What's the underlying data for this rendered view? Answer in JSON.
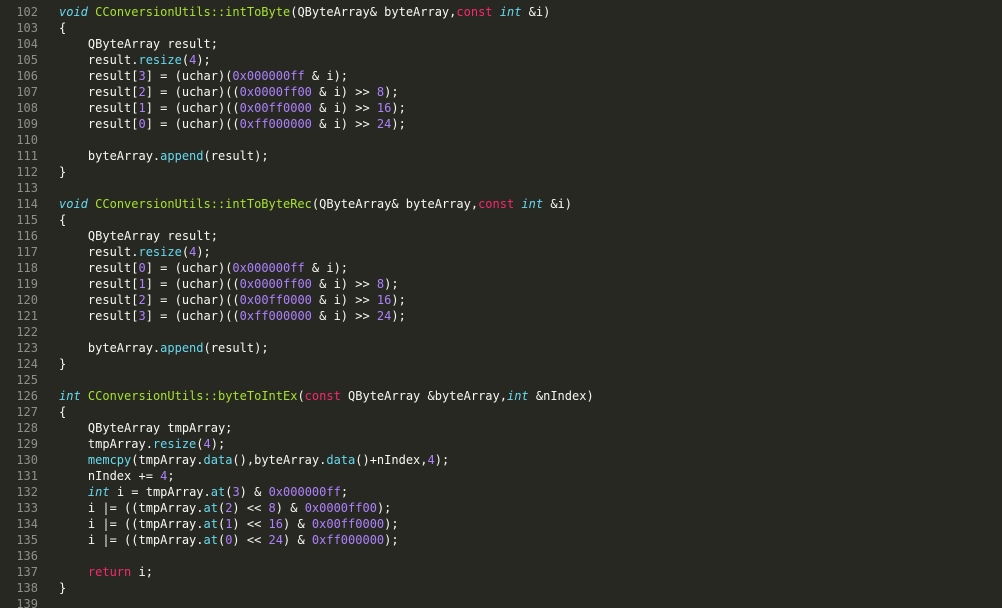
{
  "editor": {
    "theme_colors": {
      "background": "#272822",
      "line_number": "#8f908a",
      "keyword_type": "#66d9ef",
      "keyword_control": "#f92672",
      "number": "#ae81ff",
      "function_name": "#a6e22e",
      "text": "#f8f8f2"
    },
    "lines": [
      {
        "n": "102",
        "tokens": [
          [
            "kw",
            "void"
          ],
          [
            "pl",
            " "
          ],
          [
            "fn",
            "CConversionUtils::intToByte"
          ],
          [
            "pl",
            "(QByteArray& byteArray,"
          ],
          [
            "kw2",
            "const"
          ],
          [
            "pl",
            " "
          ],
          [
            "kw",
            "int"
          ],
          [
            "pl",
            " &i)"
          ]
        ]
      },
      {
        "n": "103",
        "tokens": [
          [
            "pl",
            "{"
          ]
        ]
      },
      {
        "n": "104",
        "tokens": [
          [
            "pl",
            "    QByteArray result;"
          ]
        ]
      },
      {
        "n": "105",
        "tokens": [
          [
            "pl",
            "    result."
          ],
          [
            "fn2",
            "resize"
          ],
          [
            "pl",
            "("
          ],
          [
            "num",
            "4"
          ],
          [
            "pl",
            ");"
          ]
        ]
      },
      {
        "n": "106",
        "tokens": [
          [
            "pl",
            "    result["
          ],
          [
            "num",
            "3"
          ],
          [
            "pl",
            "] = (uchar)("
          ],
          [
            "num",
            "0x000000ff"
          ],
          [
            "pl",
            " & i);"
          ]
        ]
      },
      {
        "n": "107",
        "tokens": [
          [
            "pl",
            "    result["
          ],
          [
            "num",
            "2"
          ],
          [
            "pl",
            "] = (uchar)(("
          ],
          [
            "num",
            "0x0000ff00"
          ],
          [
            "pl",
            " & i) >> "
          ],
          [
            "num",
            "8"
          ],
          [
            "pl",
            ");"
          ]
        ]
      },
      {
        "n": "108",
        "tokens": [
          [
            "pl",
            "    result["
          ],
          [
            "num",
            "1"
          ],
          [
            "pl",
            "] = (uchar)(("
          ],
          [
            "num",
            "0x00ff0000"
          ],
          [
            "pl",
            " & i) >> "
          ],
          [
            "num",
            "16"
          ],
          [
            "pl",
            ");"
          ]
        ]
      },
      {
        "n": "109",
        "tokens": [
          [
            "pl",
            "    result["
          ],
          [
            "num",
            "0"
          ],
          [
            "pl",
            "] = (uchar)(("
          ],
          [
            "num",
            "0xff000000"
          ],
          [
            "pl",
            " & i) >> "
          ],
          [
            "num",
            "24"
          ],
          [
            "pl",
            ");"
          ]
        ]
      },
      {
        "n": "110",
        "tokens": []
      },
      {
        "n": "111",
        "tokens": [
          [
            "pl",
            "    byteArray."
          ],
          [
            "fn2",
            "append"
          ],
          [
            "pl",
            "(result);"
          ]
        ]
      },
      {
        "n": "112",
        "tokens": [
          [
            "pl",
            "}"
          ]
        ]
      },
      {
        "n": "113",
        "tokens": []
      },
      {
        "n": "114",
        "tokens": [
          [
            "kw",
            "void"
          ],
          [
            "pl",
            " "
          ],
          [
            "fn",
            "CConversionUtils::intToByteRec"
          ],
          [
            "pl",
            "(QByteArray& byteArray,"
          ],
          [
            "kw2",
            "const"
          ],
          [
            "pl",
            " "
          ],
          [
            "kw",
            "int"
          ],
          [
            "pl",
            " &i)"
          ]
        ]
      },
      {
        "n": "115",
        "tokens": [
          [
            "pl",
            "{"
          ]
        ]
      },
      {
        "n": "116",
        "tokens": [
          [
            "pl",
            "    QByteArray result;"
          ]
        ]
      },
      {
        "n": "117",
        "tokens": [
          [
            "pl",
            "    result."
          ],
          [
            "fn2",
            "resize"
          ],
          [
            "pl",
            "("
          ],
          [
            "num",
            "4"
          ],
          [
            "pl",
            ");"
          ]
        ]
      },
      {
        "n": "118",
        "tokens": [
          [
            "pl",
            "    result["
          ],
          [
            "num",
            "0"
          ],
          [
            "pl",
            "] = (uchar)("
          ],
          [
            "num",
            "0x000000ff"
          ],
          [
            "pl",
            " & i);"
          ]
        ]
      },
      {
        "n": "119",
        "tokens": [
          [
            "pl",
            "    result["
          ],
          [
            "num",
            "1"
          ],
          [
            "pl",
            "] = (uchar)(("
          ],
          [
            "num",
            "0x0000ff00"
          ],
          [
            "pl",
            " & i) >> "
          ],
          [
            "num",
            "8"
          ],
          [
            "pl",
            ");"
          ]
        ]
      },
      {
        "n": "120",
        "tokens": [
          [
            "pl",
            "    result["
          ],
          [
            "num",
            "2"
          ],
          [
            "pl",
            "] = (uchar)(("
          ],
          [
            "num",
            "0x00ff0000"
          ],
          [
            "pl",
            " & i) >> "
          ],
          [
            "num",
            "16"
          ],
          [
            "pl",
            ");"
          ]
        ]
      },
      {
        "n": "121",
        "tokens": [
          [
            "pl",
            "    result["
          ],
          [
            "num",
            "3"
          ],
          [
            "pl",
            "] = (uchar)(("
          ],
          [
            "num",
            "0xff000000"
          ],
          [
            "pl",
            " & i) >> "
          ],
          [
            "num",
            "24"
          ],
          [
            "pl",
            ");"
          ]
        ]
      },
      {
        "n": "122",
        "tokens": []
      },
      {
        "n": "123",
        "tokens": [
          [
            "pl",
            "    byteArray."
          ],
          [
            "fn2",
            "append"
          ],
          [
            "pl",
            "(result);"
          ]
        ]
      },
      {
        "n": "124",
        "tokens": [
          [
            "pl",
            "}"
          ]
        ]
      },
      {
        "n": "125",
        "tokens": []
      },
      {
        "n": "126",
        "tokens": [
          [
            "kw",
            "int"
          ],
          [
            "pl",
            " "
          ],
          [
            "fn",
            "CConversionUtils::byteToIntEx"
          ],
          [
            "pl",
            "("
          ],
          [
            "kw2",
            "const"
          ],
          [
            "pl",
            " QByteArray &byteArray,"
          ],
          [
            "kw",
            "int"
          ],
          [
            "pl",
            " &nIndex)"
          ]
        ]
      },
      {
        "n": "127",
        "tokens": [
          [
            "pl",
            "{"
          ]
        ]
      },
      {
        "n": "128",
        "tokens": [
          [
            "pl",
            "    QByteArray tmpArray;"
          ]
        ]
      },
      {
        "n": "129",
        "tokens": [
          [
            "pl",
            "    tmpArray."
          ],
          [
            "fn2",
            "resize"
          ],
          [
            "pl",
            "("
          ],
          [
            "num",
            "4"
          ],
          [
            "pl",
            ");"
          ]
        ]
      },
      {
        "n": "130",
        "tokens": [
          [
            "pl",
            "    "
          ],
          [
            "fn2",
            "memcpy"
          ],
          [
            "pl",
            "(tmpArray."
          ],
          [
            "fn2",
            "data"
          ],
          [
            "pl",
            "(),byteArray."
          ],
          [
            "fn2",
            "data"
          ],
          [
            "pl",
            "()+nIndex,"
          ],
          [
            "num",
            "4"
          ],
          [
            "pl",
            ");"
          ]
        ]
      },
      {
        "n": "131",
        "tokens": [
          [
            "pl",
            "    nIndex += "
          ],
          [
            "num",
            "4"
          ],
          [
            "pl",
            ";"
          ]
        ]
      },
      {
        "n": "132",
        "tokens": [
          [
            "pl",
            "    "
          ],
          [
            "kw",
            "int"
          ],
          [
            "pl",
            " i = tmpArray."
          ],
          [
            "fn2",
            "at"
          ],
          [
            "pl",
            "("
          ],
          [
            "num",
            "3"
          ],
          [
            "pl",
            ") & "
          ],
          [
            "num",
            "0x000000ff"
          ],
          [
            "pl",
            ";"
          ]
        ]
      },
      {
        "n": "133",
        "tokens": [
          [
            "pl",
            "    i |= ((tmpArray."
          ],
          [
            "fn2",
            "at"
          ],
          [
            "pl",
            "("
          ],
          [
            "num",
            "2"
          ],
          [
            "pl",
            ") << "
          ],
          [
            "num",
            "8"
          ],
          [
            "pl",
            ") & "
          ],
          [
            "num",
            "0x0000ff00"
          ],
          [
            "pl",
            ");"
          ]
        ]
      },
      {
        "n": "134",
        "tokens": [
          [
            "pl",
            "    i |= ((tmpArray."
          ],
          [
            "fn2",
            "at"
          ],
          [
            "pl",
            "("
          ],
          [
            "num",
            "1"
          ],
          [
            "pl",
            ") << "
          ],
          [
            "num",
            "16"
          ],
          [
            "pl",
            ") & "
          ],
          [
            "num",
            "0x00ff0000"
          ],
          [
            "pl",
            ");"
          ]
        ]
      },
      {
        "n": "135",
        "tokens": [
          [
            "pl",
            "    i |= ((tmpArray."
          ],
          [
            "fn2",
            "at"
          ],
          [
            "pl",
            "("
          ],
          [
            "num",
            "0"
          ],
          [
            "pl",
            ") << "
          ],
          [
            "num",
            "24"
          ],
          [
            "pl",
            ") & "
          ],
          [
            "num",
            "0xff000000"
          ],
          [
            "pl",
            ");"
          ]
        ]
      },
      {
        "n": "136",
        "tokens": []
      },
      {
        "n": "137",
        "tokens": [
          [
            "pl",
            "    "
          ],
          [
            "kw2",
            "return"
          ],
          [
            "pl",
            " i;"
          ]
        ]
      },
      {
        "n": "138",
        "tokens": [
          [
            "pl",
            "}"
          ]
        ]
      },
      {
        "n": "139",
        "tokens": []
      }
    ]
  }
}
